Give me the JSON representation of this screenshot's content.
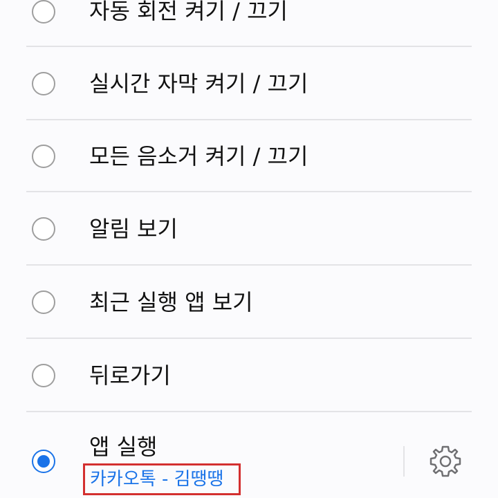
{
  "items": [
    {
      "label": "자동 회전 켜기 / 끄기",
      "selected": false
    },
    {
      "label": "실시간 자막 켜기 / 끄기",
      "selected": false
    },
    {
      "label": "모든 음소거 켜기 / 끄기",
      "selected": false
    },
    {
      "label": "알림 보기",
      "selected": false
    },
    {
      "label": "최근 실행 앱 보기",
      "selected": false
    },
    {
      "label": "뒤로가기",
      "selected": false
    },
    {
      "label": "앱 실행",
      "selected": true,
      "subtext": "카카오톡 - 김땡땡"
    }
  ],
  "colors": {
    "accent": "#1a73e8",
    "highlight_border": "#d32f2f"
  },
  "icons": {
    "settings": "gear-icon"
  }
}
